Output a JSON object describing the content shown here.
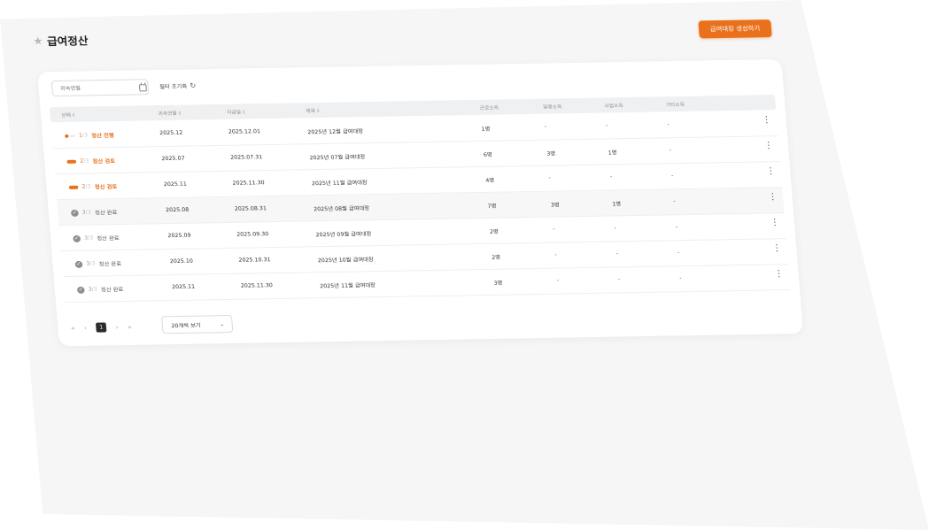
{
  "header": {
    "title": "급여정산",
    "create_button_label": "급여대장 생성하기"
  },
  "filter": {
    "period_placeholder": "귀속연월",
    "reset_label": "필터 초기화"
  },
  "table": {
    "columns": [
      "상태",
      "귀속연월",
      "지급일",
      "제목",
      "근로소득",
      "일용소득",
      "사업소득",
      "기타소득"
    ],
    "rows": [
      {
        "step": "1",
        "total": "/3",
        "status": "정산 진행",
        "period": "2025.12",
        "pay_date": "2025.12.01",
        "title": "2025년 12월 급여대장",
        "labor": "1명",
        "daily": "-",
        "business": "-",
        "other": "-"
      },
      {
        "step": "2",
        "total": "/3",
        "status": "정산 검토",
        "period": "2025.07",
        "pay_date": "2025.07.31",
        "title": "2025년 07월 급여대장",
        "labor": "6명",
        "daily": "3명",
        "business": "1명",
        "other": "-"
      },
      {
        "step": "2",
        "total": "/3",
        "status": "정산 검토",
        "period": "2025.11",
        "pay_date": "2025.11.30",
        "title": "2025년 11월 급여대장",
        "labor": "4명",
        "daily": "-",
        "business": "-",
        "other": "-"
      },
      {
        "step": "3",
        "total": "/3",
        "status": "정산 완료",
        "period": "2025.08",
        "pay_date": "2025.08.31",
        "title": "2025년 08월 급여대장",
        "labor": "7명",
        "daily": "3명",
        "business": "1명",
        "other": "-"
      },
      {
        "step": "3",
        "total": "/3",
        "status": "정산 완료",
        "period": "2025.09",
        "pay_date": "2025.09.30",
        "title": "2025년 09월 급여대장",
        "labor": "2명",
        "daily": "-",
        "business": "-",
        "other": "-"
      },
      {
        "step": "3",
        "total": "/3",
        "status": "정산 완료",
        "period": "2025.10",
        "pay_date": "2025.10.31",
        "title": "2025년 10월 급여대장",
        "labor": "2명",
        "daily": "-",
        "business": "-",
        "other": "-"
      },
      {
        "step": "3",
        "total": "/3",
        "status": "정산 완료",
        "period": "2025.11",
        "pay_date": "2025.11.30",
        "title": "2025년 11월 급여대장",
        "labor": "3명",
        "daily": "-",
        "business": "-",
        "other": "-"
      }
    ]
  },
  "pagination": {
    "current_page": "1",
    "page_size_label": "20개씩 보기"
  },
  "colors": {
    "accent": "#e9711c",
    "complete": "#8f8f8f"
  }
}
